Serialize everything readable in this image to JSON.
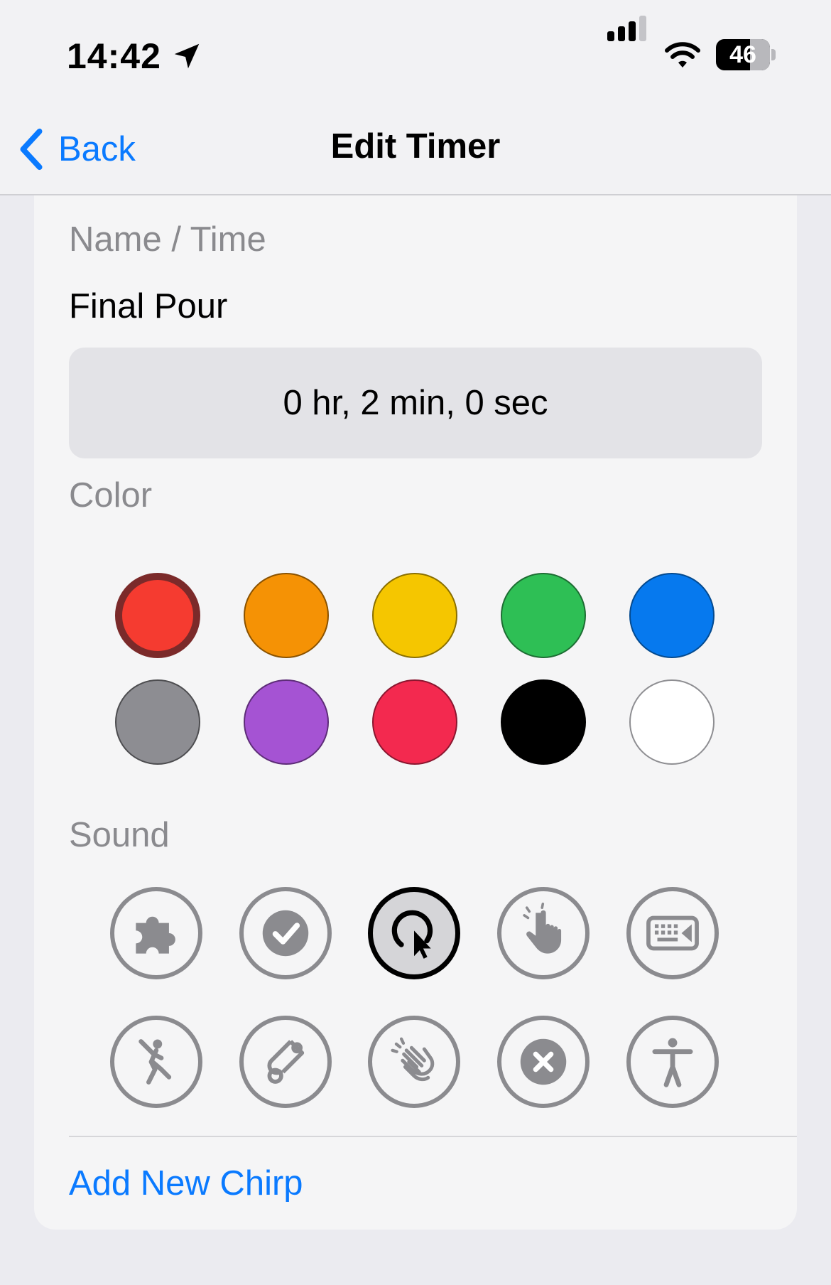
{
  "status_bar": {
    "time": "14:42",
    "battery": "46",
    "icons": [
      "location-arrow-icon",
      "cellular-signal-icon",
      "wifi-icon",
      "battery-icon"
    ]
  },
  "nav": {
    "back_label": "Back",
    "title": "Edit Timer"
  },
  "name_time": {
    "section_label": "Name / Time",
    "name": "Final Pour",
    "duration": "0 hr, 2 min, 0 sec"
  },
  "color": {
    "section_label": "Color",
    "selected": "red",
    "swatches": [
      {
        "name": "red",
        "hex": "#f53b30"
      },
      {
        "name": "orange",
        "hex": "#f59205"
      },
      {
        "name": "yellow",
        "hex": "#f5c600"
      },
      {
        "name": "green",
        "hex": "#2ebf55"
      },
      {
        "name": "blue",
        "hex": "#0679ee"
      },
      {
        "name": "gray",
        "hex": "#8d8d92"
      },
      {
        "name": "purple",
        "hex": "#a553d3"
      },
      {
        "name": "pink",
        "hex": "#f3294f"
      },
      {
        "name": "black",
        "hex": "#000000"
      },
      {
        "name": "white",
        "hex": "#ffffff"
      }
    ]
  },
  "sound": {
    "section_label": "Sound",
    "selected": "cursor-click",
    "options": [
      "puzzle-piece-icon",
      "checkmark-icon",
      "cursor-click-icon",
      "hand-tap-icon",
      "keyboard-icon",
      "baseball-batter-icon",
      "scroll-icon",
      "hands-clap-icon",
      "x-mark-icon",
      "accessibility-icon"
    ]
  },
  "add_chirp_label": "Add New Chirp"
}
